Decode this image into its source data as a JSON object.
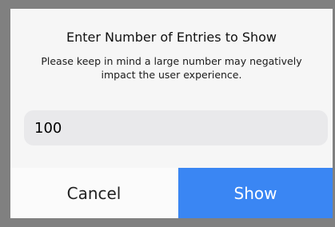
{
  "dialog": {
    "title": "Enter Number of Entries to Show",
    "message": "Please keep in mind a large number may negatively impact the user experience.",
    "input_value": "100",
    "cancel_label": "Cancel",
    "show_label": "Show"
  },
  "colors": {
    "backdrop": "#808080",
    "dialog_background": "#f6f6f6",
    "input_background": "#e9e9eb",
    "primary_button": "#3a86f3",
    "secondary_button": "#fbfbfb"
  }
}
